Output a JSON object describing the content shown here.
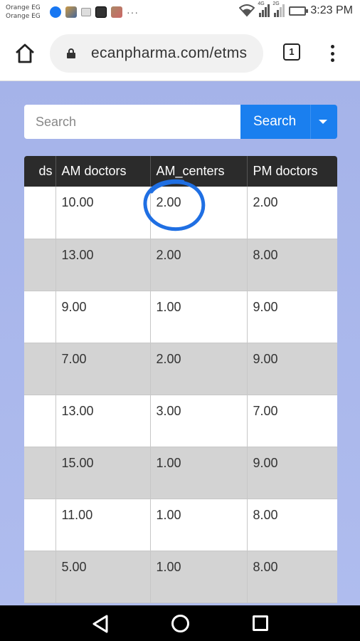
{
  "status_bar": {
    "carrier_line1": "Orange EG",
    "carrier_line2": "Orange EG",
    "overflow_indicator": "···",
    "network1": "4G",
    "network2": "2G",
    "time": "3:23 PM"
  },
  "browser": {
    "url": "ecanpharma.com/etms",
    "tab_count": "1"
  },
  "search": {
    "placeholder": "Search",
    "button_label": "Search"
  },
  "table": {
    "columns": [
      "ds",
      "AM doctors",
      "AM_centers",
      "PM doctors"
    ],
    "rows": [
      [
        "",
        "10.00",
        "2.00",
        "2.00"
      ],
      [
        "",
        "13.00",
        "2.00",
        "8.00"
      ],
      [
        "",
        "9.00",
        "1.00",
        "9.00"
      ],
      [
        "",
        "7.00",
        "2.00",
        "9.00"
      ],
      [
        "",
        "13.00",
        "3.00",
        "7.00"
      ],
      [
        "",
        "15.00",
        "1.00",
        "9.00"
      ],
      [
        "",
        "11.00",
        "1.00",
        "8.00"
      ],
      [
        "",
        "5.00",
        "1.00",
        "8.00"
      ]
    ]
  },
  "annotation": {
    "circle_color": "#1f6fe3"
  }
}
